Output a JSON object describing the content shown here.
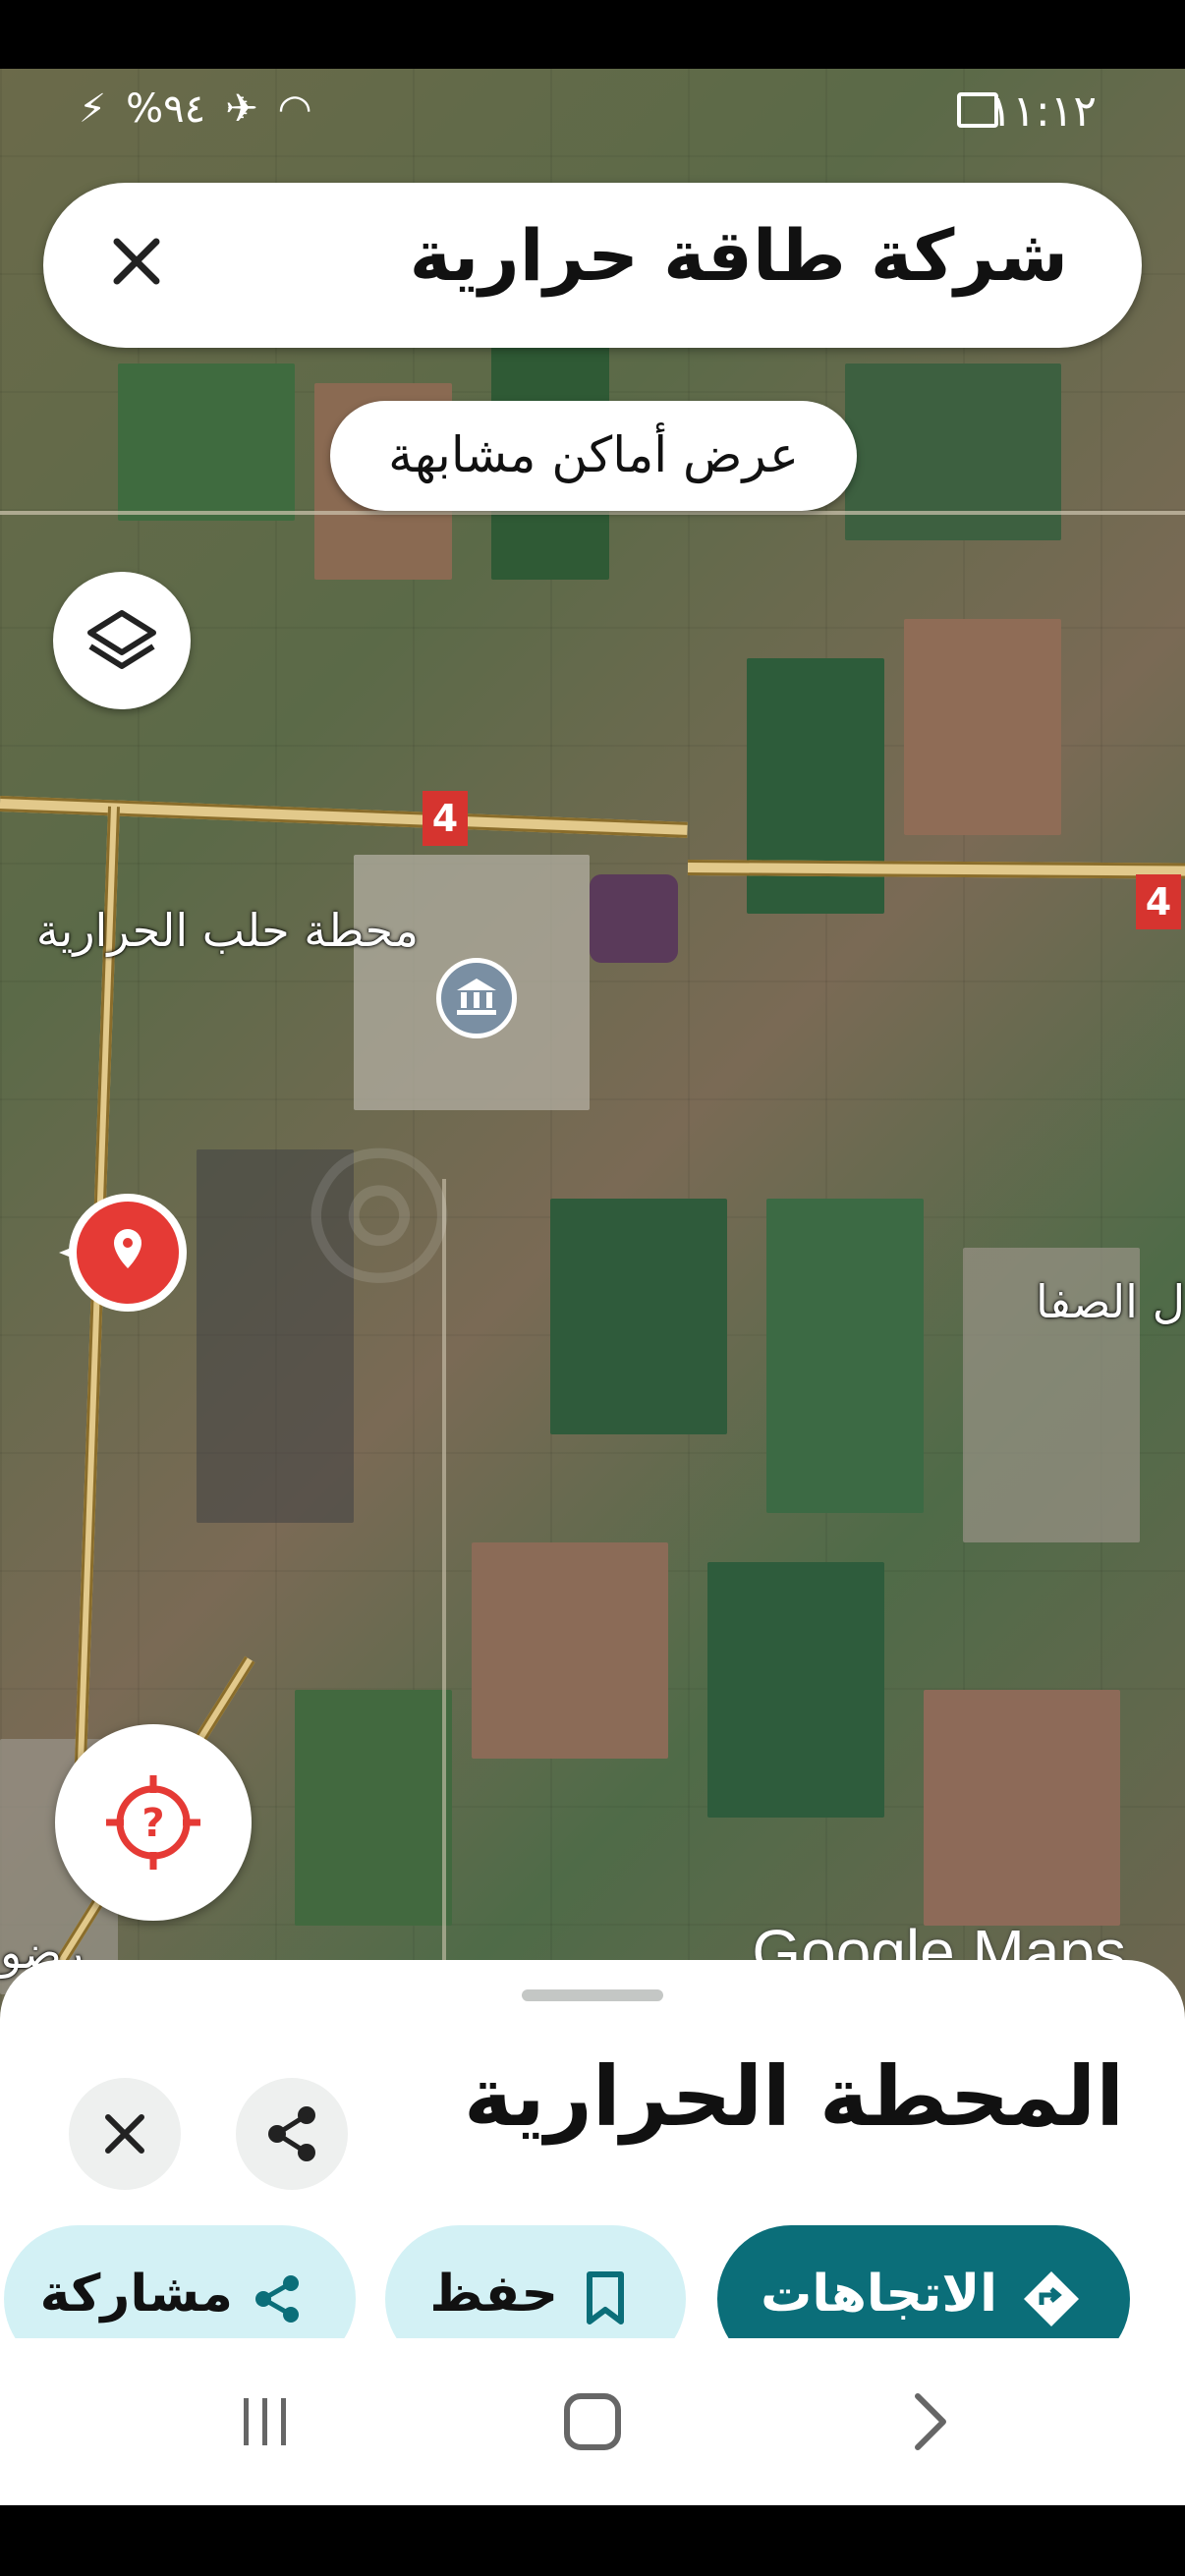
{
  "status_bar": {
    "time": "١١:١٢",
    "battery": "%٩٤"
  },
  "search": {
    "query": "شركة طاقة حرارية"
  },
  "similar_places": {
    "label": "عرض أماكن مشابهة"
  },
  "map": {
    "route_number": "4",
    "labels": {
      "station": "محطة حلب الحرارية",
      "town": "ل الصفا",
      "partial": "رضو"
    },
    "attribution": "Google Maps"
  },
  "place_sheet": {
    "title": "المحطة الحرارية",
    "actions": {
      "directions": "الاتجاهات",
      "save": "حفظ",
      "share": "مشاركة"
    }
  },
  "colors": {
    "directions_bg": "#0b6e79",
    "chip_light_bg": "#d3f1f5",
    "pin_red": "#e53a35"
  }
}
